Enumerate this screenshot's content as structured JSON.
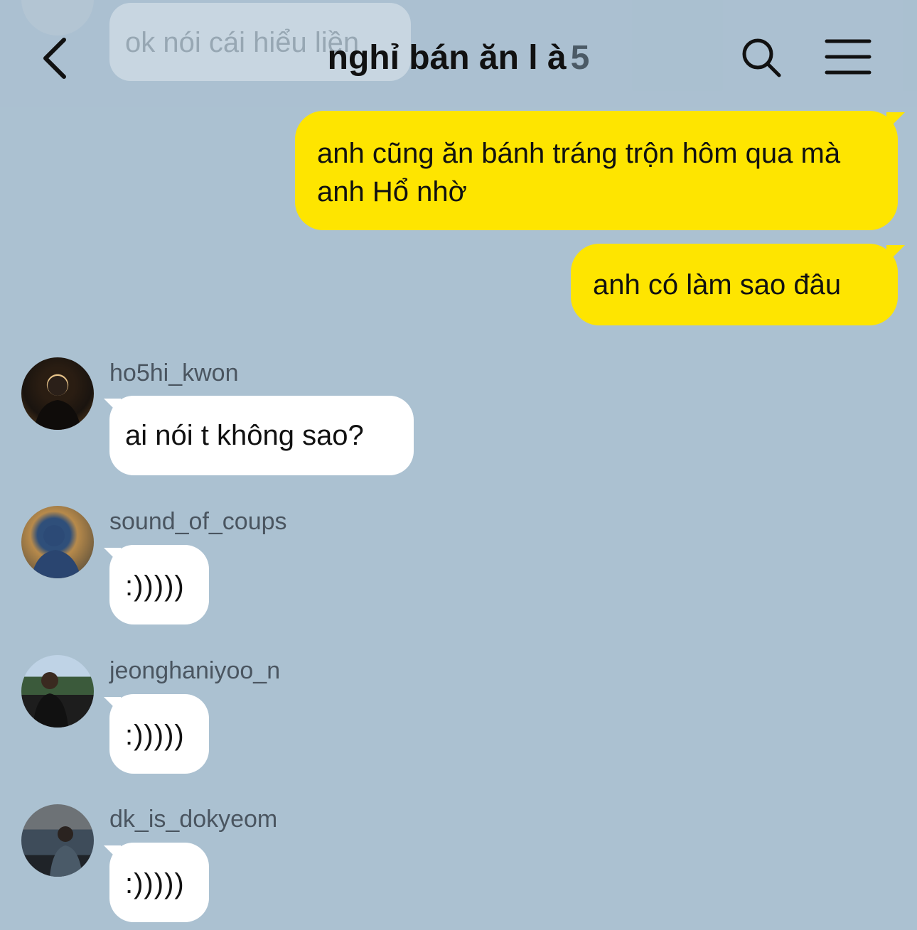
{
  "header": {
    "title": "nghỉ bán ăn l à",
    "member_count": "5",
    "back_icon": "chevron-left-icon",
    "search_icon": "search-icon",
    "menu_icon": "menu-icon"
  },
  "ghost_message": {
    "text": "ok nói cái hiểu liền"
  },
  "outgoing": [
    {
      "text": "anh cũng ăn bánh tráng trộn hôm qua mà anh Hổ nhờ"
    },
    {
      "text": "anh có làm sao đâu"
    }
  ],
  "incoming": [
    {
      "sender": "ho5hi_kwon",
      "text": "ai nói t không sao?"
    },
    {
      "sender": "sound_of_coups",
      "text": ":)))))"
    },
    {
      "sender": "jeonghaniyoo_n",
      "text": ":)))))"
    },
    {
      "sender": "dk_is_dokyeom",
      "text": ":)))))"
    }
  ],
  "colors": {
    "background": "#abc1d1",
    "outgoing_bubble": "#fee500",
    "incoming_bubble": "#ffffff"
  }
}
